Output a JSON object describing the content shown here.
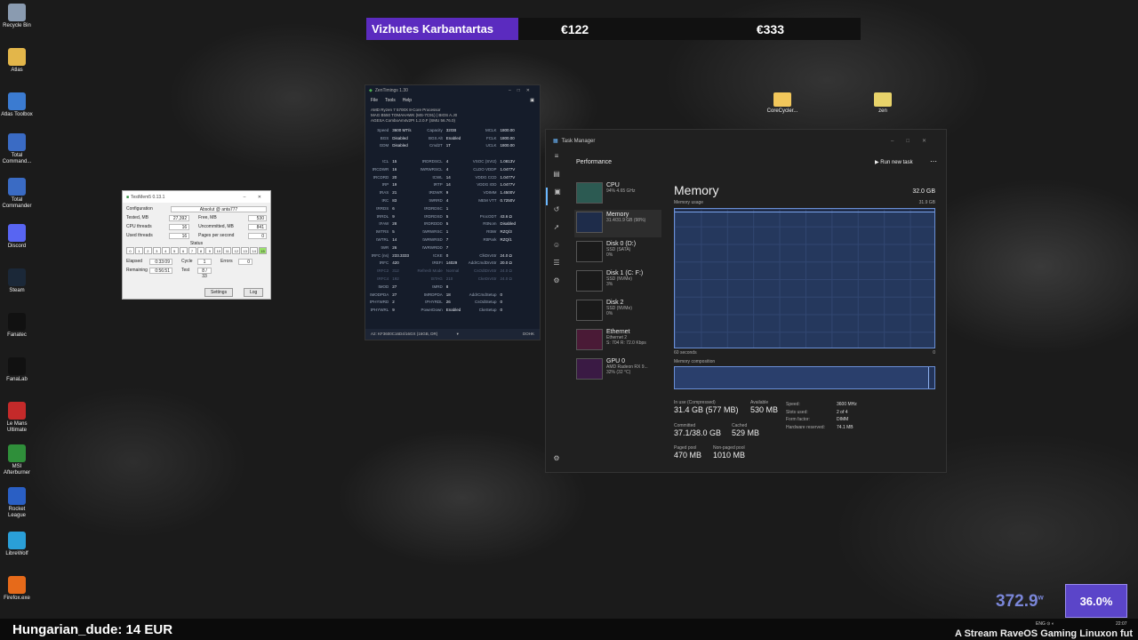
{
  "desktop_icons": [
    {
      "label": "Recycle Bin",
      "icon": "recycle-bin-icon",
      "color": "#8a9bb0"
    },
    {
      "label": "Atlas",
      "icon": "atlas-icon",
      "color": "#e3b64a"
    },
    {
      "label": "Atlas Toolbox",
      "icon": "toolbox-icon",
      "color": "#3b7bd1"
    },
    {
      "label": "Total Command...",
      "icon": "total-commander-icon",
      "color": "#3a6bc4"
    },
    {
      "label": "Total Commander",
      "icon": "total-commander-icon",
      "color": "#3a6bc4"
    },
    {
      "label": "Discord",
      "icon": "discord-icon",
      "color": "#5865f2"
    },
    {
      "label": "Steam",
      "icon": "steam-icon",
      "color": "#1b2838"
    },
    {
      "label": "Fanatec",
      "icon": "fanatec-icon",
      "color": "#111111"
    },
    {
      "label": "FanaLab",
      "icon": "fanalab-icon",
      "color": "#111111"
    },
    {
      "label": "Le Mans Ultimate",
      "icon": "le-mans-icon",
      "color": "#c42a2a"
    },
    {
      "label": "MSI Afterburner",
      "icon": "msi-afterburner-icon",
      "color": "#2f8f3a"
    },
    {
      "label": "Rocket League",
      "icon": "rocket-league-icon",
      "color": "#2a5fc4"
    },
    {
      "label": "LibreWolf",
      "icon": "librewolf-icon",
      "color": "#2a9fd8"
    },
    {
      "label": "Firefox.exe",
      "icon": "firefox-icon",
      "color": "#e66a1a"
    }
  ],
  "banner": {
    "name": "Vizhutes Karbantartas",
    "value1": "€122",
    "value2": "€333"
  },
  "folders": [
    {
      "label": "CoreCycler..."
    },
    {
      "label": "zen"
    }
  ],
  "testmem": {
    "title": "TestMem5  0.13.1",
    "config_label": "Configuration",
    "config_value": "Absolut @ anta777",
    "tested_label": "Tested, MB",
    "tested_value": "27,392",
    "free_label": "Free, MB",
    "free_value": "530",
    "cpu_label": "CPU threads",
    "cpu_value": "16",
    "uncommitted_label": "Uncommitted, MB",
    "uncommitted_value": "841",
    "used_label": "Used threads",
    "used_value": "16",
    "pages_label": "Pages per second",
    "pages_value": "0",
    "status_label": "Status",
    "cells": [
      "0",
      "1",
      "2",
      "3",
      "4",
      "5",
      "6",
      "7",
      "8",
      "9",
      "10",
      "11",
      "12",
      "13",
      "14",
      "15"
    ],
    "elapsed_label": "Elapsed",
    "elapsed_value": "0:33:09",
    "cycle_label": "Cycle",
    "cycle_value": "1",
    "errors_label": "Errors",
    "errors_value": "0",
    "remaining_label": "Remaining",
    "remaining_value": "0:56:51",
    "test_label": "Test",
    "test_value": "8 / 33",
    "settings_btn": "Settings",
    "log_btn": "Log"
  },
  "zentimings": {
    "title": "ZenTimings 1.30",
    "menu": [
      "File",
      "Tools",
      "Help"
    ],
    "info": [
      "AMD Ryzen 7 5700X 8-Core Processor",
      "MAG B550 TOMAHAWK (MS-7C91) | BIOS A.J0",
      "AGESA ComboAm4v2PI 1.2.0.F (SMU 56.76.0)"
    ],
    "rows": [
      [
        "Speed",
        "3600 MT/s",
        "Capacity",
        "32GB",
        "MCLK",
        "1800.00"
      ],
      [
        "BGS",
        "Disabled",
        "BGS Alt",
        "Enabled",
        "FCLK",
        "1800.00"
      ],
      [
        "GDM",
        "Disabled",
        "Cmd2T",
        "1T",
        "UCLK",
        "1800.00"
      ],
      [
        "",
        "",
        "",
        "",
        "",
        ""
      ],
      [
        "tCL",
        "15",
        "tRDRDSCL",
        "4",
        "VSOC (SVI2)",
        "1.0813V"
      ],
      [
        "tRCDWR",
        "16",
        "tWRWRSCL",
        "4",
        "CLDO VDDP",
        "1.0477V"
      ],
      [
        "tRCDRD",
        "20",
        "tCWL",
        "14",
        "VDDG CCD",
        "1.0477V"
      ],
      [
        "tRP",
        "19",
        "tRTP",
        "14",
        "VDDG IOD",
        "1.0477V"
      ],
      [
        "tRAS",
        "21",
        "tRDWR",
        "9",
        "VDIMM",
        "1.4500V"
      ],
      [
        "tRC",
        "83",
        "tWRRD",
        "4",
        "MEM VTT",
        "0.7250V"
      ],
      [
        "tRRDS",
        "6",
        "tRDRDSC",
        "1",
        "",
        ""
      ],
      [
        "tRRDL",
        "9",
        "tRDRDSD",
        "5",
        "ProcODT",
        "43.6 Ω"
      ],
      [
        "tFAW",
        "28",
        "tRDRDDD",
        "5",
        "RttNom",
        "Disabled"
      ],
      [
        "tWTRS",
        "5",
        "tWRWRSC",
        "1",
        "RttWr",
        "RZQ/3"
      ],
      [
        "tWTRL",
        "14",
        "tWRWRSD",
        "7",
        "RttPark",
        "RZQ/1"
      ],
      [
        "tWR",
        "26",
        "tWRWRDD",
        "7",
        "",
        ""
      ],
      [
        "tRFC (ns)",
        "233.3333",
        "tCKE",
        "0",
        "ClkDrvStr",
        "24.0 Ω"
      ],
      [
        "tRFC",
        "420",
        "tREFI",
        "14029",
        "AddrCmdDrvStr",
        "20.0 Ω"
      ],
      [
        "tRFC2",
        "312",
        "Refresh Mode",
        "Normal",
        "CsOdtDrvStr",
        "24.0 Ω"
      ],
      [
        "tRFC4",
        "192",
        "tSTAG",
        "210",
        "CkeDrvStr",
        "24.0 Ω"
      ],
      [
        "tMOD",
        "27",
        "tMRD",
        "8",
        "",
        ""
      ],
      [
        "tMODPDA",
        "27",
        "tMRDPDA",
        "18",
        "AddrCmdSetup",
        "0"
      ],
      [
        "tPHYWRD",
        "2",
        "tPHYRDL",
        "26",
        "CsOdtSetup",
        "0"
      ],
      [
        "tPHYWRL",
        "9",
        "PowerDown",
        "Enabled",
        "CkeSetup",
        "0"
      ]
    ],
    "footer": "A2: KF3600C16D4/16GX (16GB, DR)",
    "footer_right": "DOHK"
  },
  "taskmanager": {
    "title": "Task Manager",
    "header": "Performance",
    "run_task": "Run new task",
    "resources": [
      {
        "name": "CPU",
        "sub1": "94%  4.65 GHz",
        "sub2": ""
      },
      {
        "name": "Memory",
        "sub1": "31.4/31.9 GB (98%)",
        "sub2": ""
      },
      {
        "name": "Disk 0 (D:)",
        "sub1": "SSD (SATA)",
        "sub2": "0%"
      },
      {
        "name": "Disk 1 (C: F:)",
        "sub1": "SSD (NVMe)",
        "sub2": "3%"
      },
      {
        "name": "Disk 2",
        "sub1": "SSD (NVMe)",
        "sub2": "0%"
      },
      {
        "name": "Ethernet",
        "sub1": "Ethernet 2",
        "sub2": "S: 704  R: 72.0 Kbps"
      },
      {
        "name": "GPU 0",
        "sub1": "AMD Radeon RX 9...",
        "sub2": "32% (32 °C)"
      }
    ],
    "mem_title": "Memory",
    "mem_total": "32.0 GB",
    "usage_label": "Memory usage",
    "usage_max": "31.9 GB",
    "seconds_label": "60 seconds",
    "zero_label": "0",
    "composition_label": "Memory composition",
    "inuse_label": "In use (Compressed)",
    "inuse_value": "31.4 GB (577 MB)",
    "available_label": "Available",
    "available_value": "530 MB",
    "committed_label": "Committed",
    "committed_value": "37.1/38.0 GB",
    "cached_label": "Cached",
    "cached_value": "529 MB",
    "paged_label": "Paged pool",
    "paged_value": "470 MB",
    "nonpaged_label": "Non-paged pool",
    "nonpaged_value": "1010 MB",
    "speed_label": "Speed:",
    "speed_value": "3600 MHz",
    "slots_label": "Slots used:",
    "slots_value": "2 of 4",
    "form_label": "Form factor:",
    "form_value": "DIMM",
    "hwres_label": "Hardware reserved:",
    "hwres_value": "74.1 MB",
    "usage_fraction": 0.98
  },
  "overlay": {
    "watts": "372.9",
    "watts_unit": "w",
    "percent": "36.0%"
  },
  "taskbar": {
    "donation": "Hungarian_dude: 14 EUR",
    "ticker": "A Stream RaveOS Gaming Linuxon fut",
    "lang": "ENG",
    "clock": "22:07"
  }
}
